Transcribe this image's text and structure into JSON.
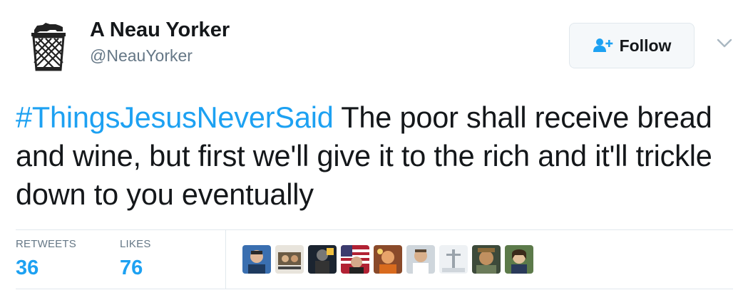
{
  "author": {
    "name": "A Neau Yorker",
    "handle": "@NeauYorker",
    "avatar_icon": "trash-can-bear-icon"
  },
  "follow_button": {
    "label": "Follow",
    "icon": "add-user-icon"
  },
  "more_menu_icon": "chevron-down-icon",
  "tweet": {
    "hashtag": "#ThingsJesusNeverSaid",
    "text": " The poor shall receive bread and wine, but first we'll give it to the rich and it'll trickle down to you eventually"
  },
  "stats": {
    "retweets_label": "RETWEETS",
    "retweets_count": "36",
    "likes_label": "LIKES",
    "likes_count": "76"
  },
  "likers": [
    {
      "name": "liker-1"
    },
    {
      "name": "liker-2"
    },
    {
      "name": "liker-3"
    },
    {
      "name": "liker-4"
    },
    {
      "name": "liker-5"
    },
    {
      "name": "liker-6"
    },
    {
      "name": "liker-7"
    },
    {
      "name": "liker-8"
    },
    {
      "name": "liker-9"
    }
  ],
  "colors": {
    "link": "#1da1f2",
    "text": "#14171a",
    "secondary": "#657786",
    "border": "#e1e8ed"
  }
}
